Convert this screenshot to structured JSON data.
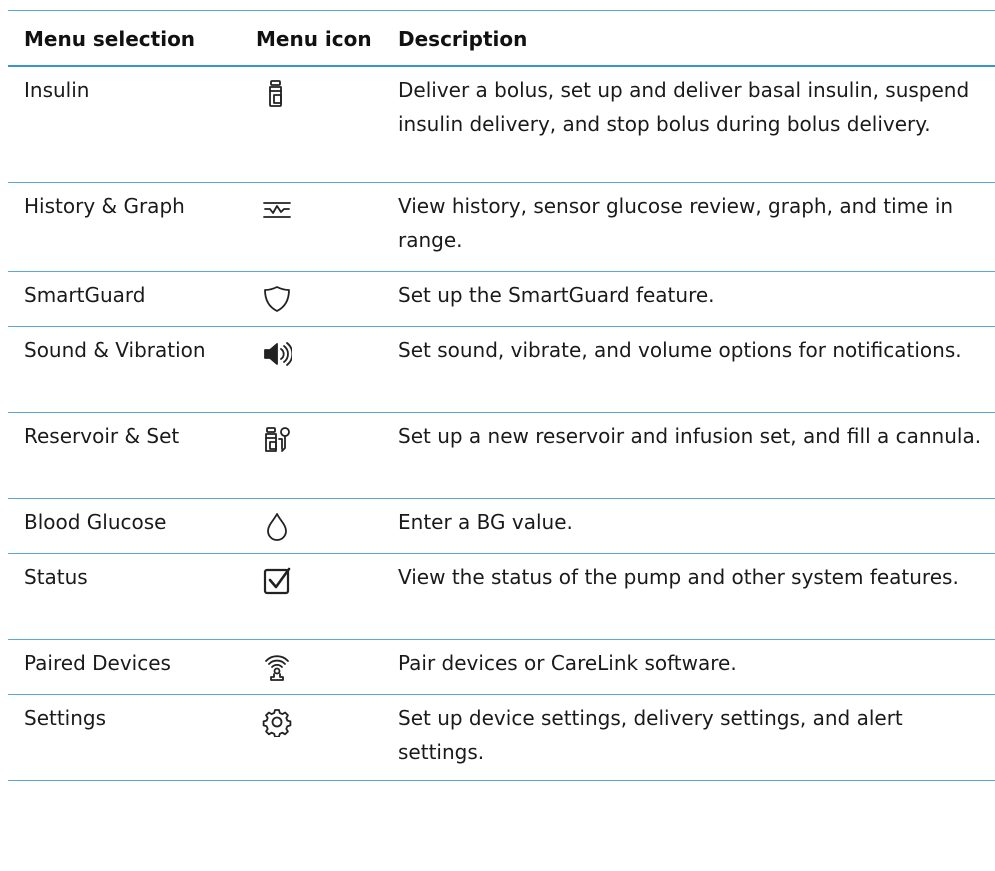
{
  "table": {
    "headers": {
      "menu_selection": "Menu selection",
      "menu_icon": "Menu icon",
      "description": "Description"
    },
    "rows": [
      {
        "selection": "Insulin",
        "icon": "insulin-vial-icon",
        "description": "Deliver a bolus, set up and deliver basal insulin, suspend insulin delivery, and stop bolus during bolus delivery."
      },
      {
        "selection": "History & Graph",
        "icon": "history-graph-icon",
        "description": "View history, sensor glucose review, graph, and time in range."
      },
      {
        "selection": "SmartGuard",
        "icon": "shield-icon",
        "description": "Set up the SmartGuard feature."
      },
      {
        "selection": "Sound & Vibration",
        "icon": "speaker-icon",
        "description": "Set sound, vibrate, and volume options for notifications."
      },
      {
        "selection": "Reservoir & Set",
        "icon": "reservoir-set-icon",
        "description": "Set up a new reservoir and infusion set, and fill a cannula."
      },
      {
        "selection": "Blood Glucose",
        "icon": "blood-drop-icon",
        "description": "Enter a BG value."
      },
      {
        "selection": "Status",
        "icon": "status-checkbox-icon",
        "description": "View the status of the pump and other system features."
      },
      {
        "selection": "Paired Devices",
        "icon": "paired-devices-icon",
        "description": "Pair devices or CareLink software."
      },
      {
        "selection": "Settings",
        "icon": "gear-icon",
        "description": "Set up device settings, delivery settings, and alert settings."
      }
    ]
  }
}
